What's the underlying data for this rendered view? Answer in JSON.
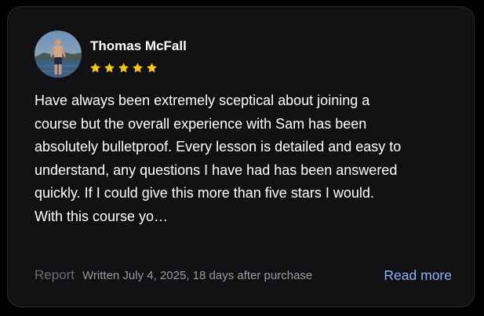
{
  "review": {
    "author": "Thomas McFall",
    "rating": 5,
    "rating_max": 5,
    "star_color": "#f5c518",
    "avatar_icon": "user-photo",
    "text_lines": [
      "Have always been extremely sceptical about joining a",
      "course but the overall experience with Sam has been",
      "absolutely bulletproof. Every lesson is detailed and easy to",
      "understand, any questions I have had has been answered",
      "quickly. If I could give this more than five stars I would.",
      "With this course yo…"
    ],
    "report_label": "Report",
    "written_text": "Written July 4, 2025, 18 days after purchase",
    "read_more_label": "Read more",
    "link_color": "#8ab4f8"
  }
}
